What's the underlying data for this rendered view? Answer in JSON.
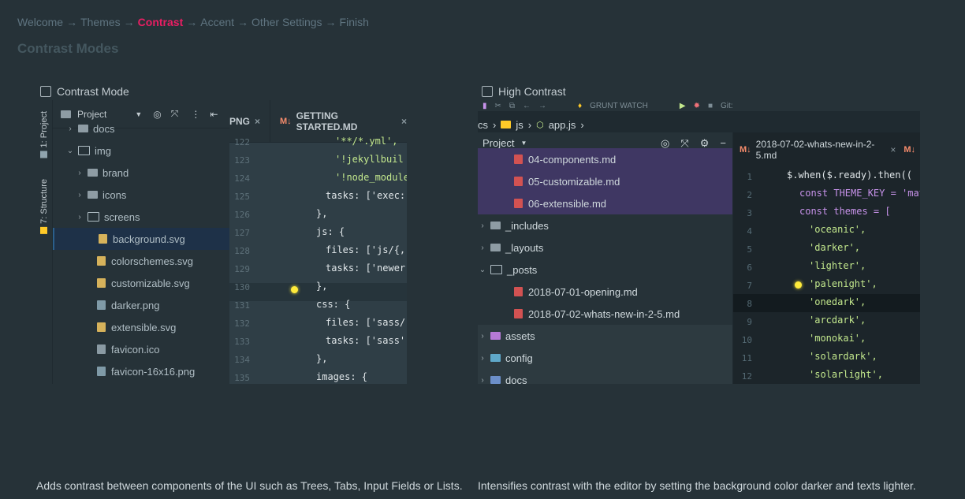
{
  "breadcrumb": [
    "Welcome",
    "Themes",
    "Contrast",
    "Accent",
    "Other Settings",
    "Finish"
  ],
  "breadcrumb_active": "Contrast",
  "breadcrumb_separator": "→",
  "page_title": "Contrast Modes",
  "options": {
    "contrast_mode": {
      "label": "Contrast Mode",
      "checked": false,
      "description": "Adds contrast between components of the UI such as Trees, Tabs, Input Fields or Lists."
    },
    "high_contrast": {
      "label": "High Contrast",
      "checked": false,
      "description": "Intensifies contrast with the editor by setting the background color darker and texts lighter."
    }
  },
  "preview1": {
    "side_tabs": [
      "1: Project",
      "7: Structure"
    ],
    "project_label": "Project",
    "tree": [
      {
        "name": "docs",
        "type": "folder"
      },
      {
        "name": "img",
        "type": "folder-open"
      },
      {
        "name": "brand",
        "type": "folder"
      },
      {
        "name": "icons",
        "type": "folder"
      },
      {
        "name": "screens",
        "type": "folder-outline"
      },
      {
        "name": "background.svg",
        "type": "svg",
        "selected": true
      },
      {
        "name": "colorschemes.svg",
        "type": "svg"
      },
      {
        "name": "customizable.svg",
        "type": "svg"
      },
      {
        "name": "darker.png",
        "type": "png"
      },
      {
        "name": "extensible.svg",
        "type": "svg"
      },
      {
        "name": "favicon.ico",
        "type": "ico"
      },
      {
        "name": "favicon-16x16.png",
        "type": "png"
      }
    ],
    "tabs": [
      "PNG",
      "GETTING STARTED.MD"
    ],
    "tab_close": "×",
    "line_numbers": [
      "122",
      "123",
      "124",
      "125",
      "126",
      "127",
      "128",
      "129",
      "130",
      "131",
      "132",
      "133",
      "134",
      "135"
    ],
    "code": [
      "'**/*.yml',",
      "'!jekyllbuil",
      "'!node_module",
      "tasks: ['exec:",
      "},",
      "js: {",
      "files: ['js/{,",
      "tasks: ['newer",
      "},",
      "css: {",
      "files: ['sass/",
      "tasks: ['sass',",
      "},",
      "images: {"
    ]
  },
  "preview2": {
    "toolbar_text": "GRUNT WATCH",
    "git_label": "Git:",
    "nav": [
      "cs",
      "js",
      "app.js"
    ],
    "project_label": "Project",
    "tree": [
      {
        "name": "04-components.md",
        "type": "md",
        "highlight": true
      },
      {
        "name": "05-customizable.md",
        "type": "md",
        "highlight": true
      },
      {
        "name": "06-extensible.md",
        "type": "md",
        "highlight": true
      },
      {
        "name": "_includes",
        "type": "folder"
      },
      {
        "name": "_layouts",
        "type": "folder"
      },
      {
        "name": "_posts",
        "type": "folder-open"
      },
      {
        "name": "2018-07-01-opening.md",
        "type": "md"
      },
      {
        "name": "2018-07-02-whats-new-in-2-5.md",
        "type": "md"
      },
      {
        "name": "assets",
        "type": "folder",
        "dark": true
      },
      {
        "name": "config",
        "type": "folder",
        "dark": true
      },
      {
        "name": "docs",
        "type": "folder",
        "dark": true
      }
    ],
    "tab": "2018-07-02-whats-new-in-2-5.md",
    "tab_close": "×",
    "line_numbers": [
      "1",
      "2",
      "3",
      "4",
      "5",
      "6",
      "7",
      "8",
      "9",
      "10",
      "11",
      "12"
    ],
    "code": [
      "$.when($.ready).then((",
      "const THEME_KEY = 'mat",
      "const themes = [",
      "'oceanic',",
      "'darker',",
      "'lighter',",
      "'palenight',",
      "'onedark',",
      "'arcdark',",
      "'monokai',",
      "'solardark',",
      "'solarlight',"
    ]
  },
  "colors": {
    "background": "#263238",
    "accent": "#e91e63",
    "highlight": "#3f3763"
  }
}
